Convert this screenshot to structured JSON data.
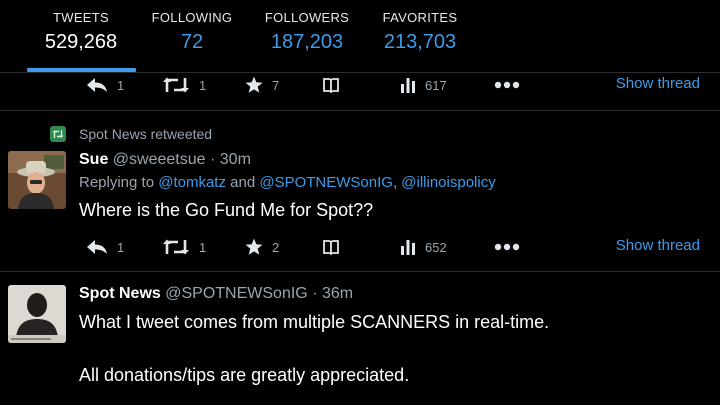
{
  "stats": {
    "tweets": {
      "label": "TWEETS",
      "value": "529,268"
    },
    "following": {
      "label": "FOLLOWING",
      "value": "72"
    },
    "followers": {
      "label": "FOLLOWERS",
      "value": "187,203"
    },
    "favorites": {
      "label": "FAVORITES",
      "value": "213,703"
    }
  },
  "tweet_top": {
    "actions": {
      "reply": "1",
      "retweet": "1",
      "favorite": "7",
      "views": "617",
      "show_thread": "Show thread"
    }
  },
  "tweet_sue": {
    "retweet_note": "Spot News retweeted",
    "name": "Sue",
    "handle": "@sweeetsue",
    "dot": "·",
    "time": "30m",
    "reply_prefix": "Replying to",
    "mention1": "@tomkatz",
    "and_text": "and",
    "mention2": "@SPOTNEWSonIG",
    "comma": ",",
    "mention3": "@illinoispolicy",
    "text": "Where is the Go Fund Me for Spot??",
    "actions": {
      "reply": "1",
      "retweet": "1",
      "favorite": "2",
      "views": "652",
      "show_thread": "Show thread"
    }
  },
  "tweet_spot": {
    "name": "Spot News",
    "handle": "@SPOTNEWSonIG",
    "dot": "·",
    "time": "36m",
    "line1": "What I tweet comes from multiple SCANNERS in real-time.",
    "line2": "All donations/tips are greatly appreciated."
  },
  "icons": [
    "reply-icon",
    "retweet-icon",
    "star-icon",
    "book-icon",
    "bar-chart-icon",
    "more-icon"
  ],
  "colors": {
    "accent": "#3d9be9",
    "background": "#000000",
    "retweet_green": "#2f8a4f",
    "muted": "#9aa4ad"
  }
}
